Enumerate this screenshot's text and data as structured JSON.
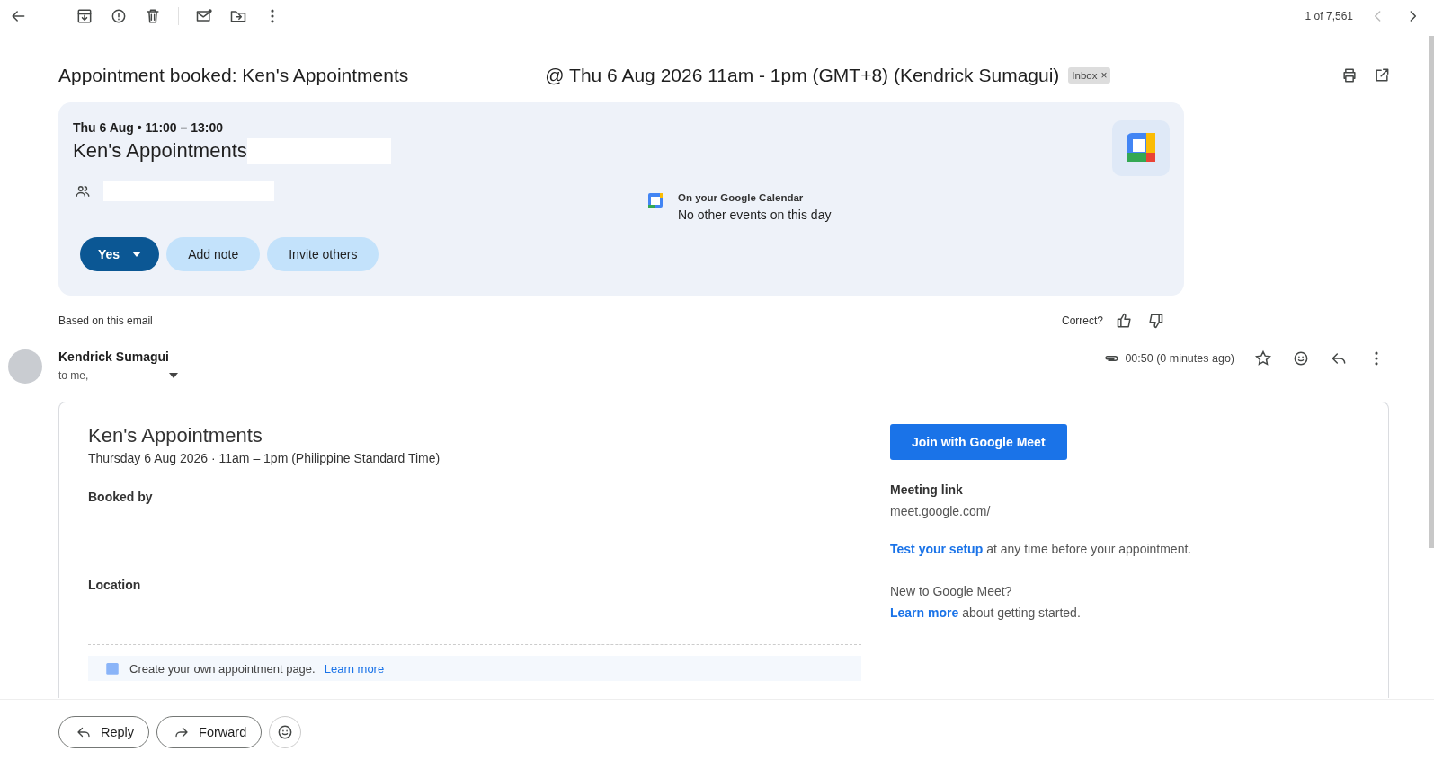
{
  "toolbar": {
    "counter": "1 of 7,561"
  },
  "subject": {
    "title": "Appointment booked: Ken's Appointments",
    "details": "@ Thu 6 Aug 2026 11am - 1pm (GMT+8) (Kendrick Sumagui)",
    "labels": [
      {
        "text": "Inbox",
        "close": "×"
      }
    ]
  },
  "event_card": {
    "date_time": "Thu 6 Aug • 11:00 – 13:00",
    "title": "Ken's Appointments",
    "calendar_heading": "On your Google Calendar",
    "calendar_note": "No other events on this day",
    "rsvp": "Yes",
    "buttons": [
      "Add note",
      "Invite others"
    ]
  },
  "feedback": {
    "source": "Based on this email",
    "question": "Correct?"
  },
  "message": {
    "sender": "Kendrick Sumagui",
    "recipient": "to me,",
    "time": "00:50 (0 minutes ago)",
    "starred": false
  },
  "body": {
    "title": "Ken's Appointments",
    "date_time": "Thursday 6 Aug 2026 · 11am – 1pm (Philippine Standard Time)",
    "booked_by": "Booked by",
    "location": "Location",
    "join_button": "Join with Google Meet",
    "meeting_link_label": "Meeting link",
    "meeting_link": "meet.google.com/",
    "setup_link": "Test your setup",
    "setup_text": "at any time before your appointment.",
    "new_question": "New to Google Meet?",
    "learn_link": "Learn more",
    "learn_text": "about getting started.",
    "footer_text": "Create your own appointment page.",
    "footer_link": "Learn more"
  },
  "actions": [
    "Reply",
    "Forward"
  ]
}
